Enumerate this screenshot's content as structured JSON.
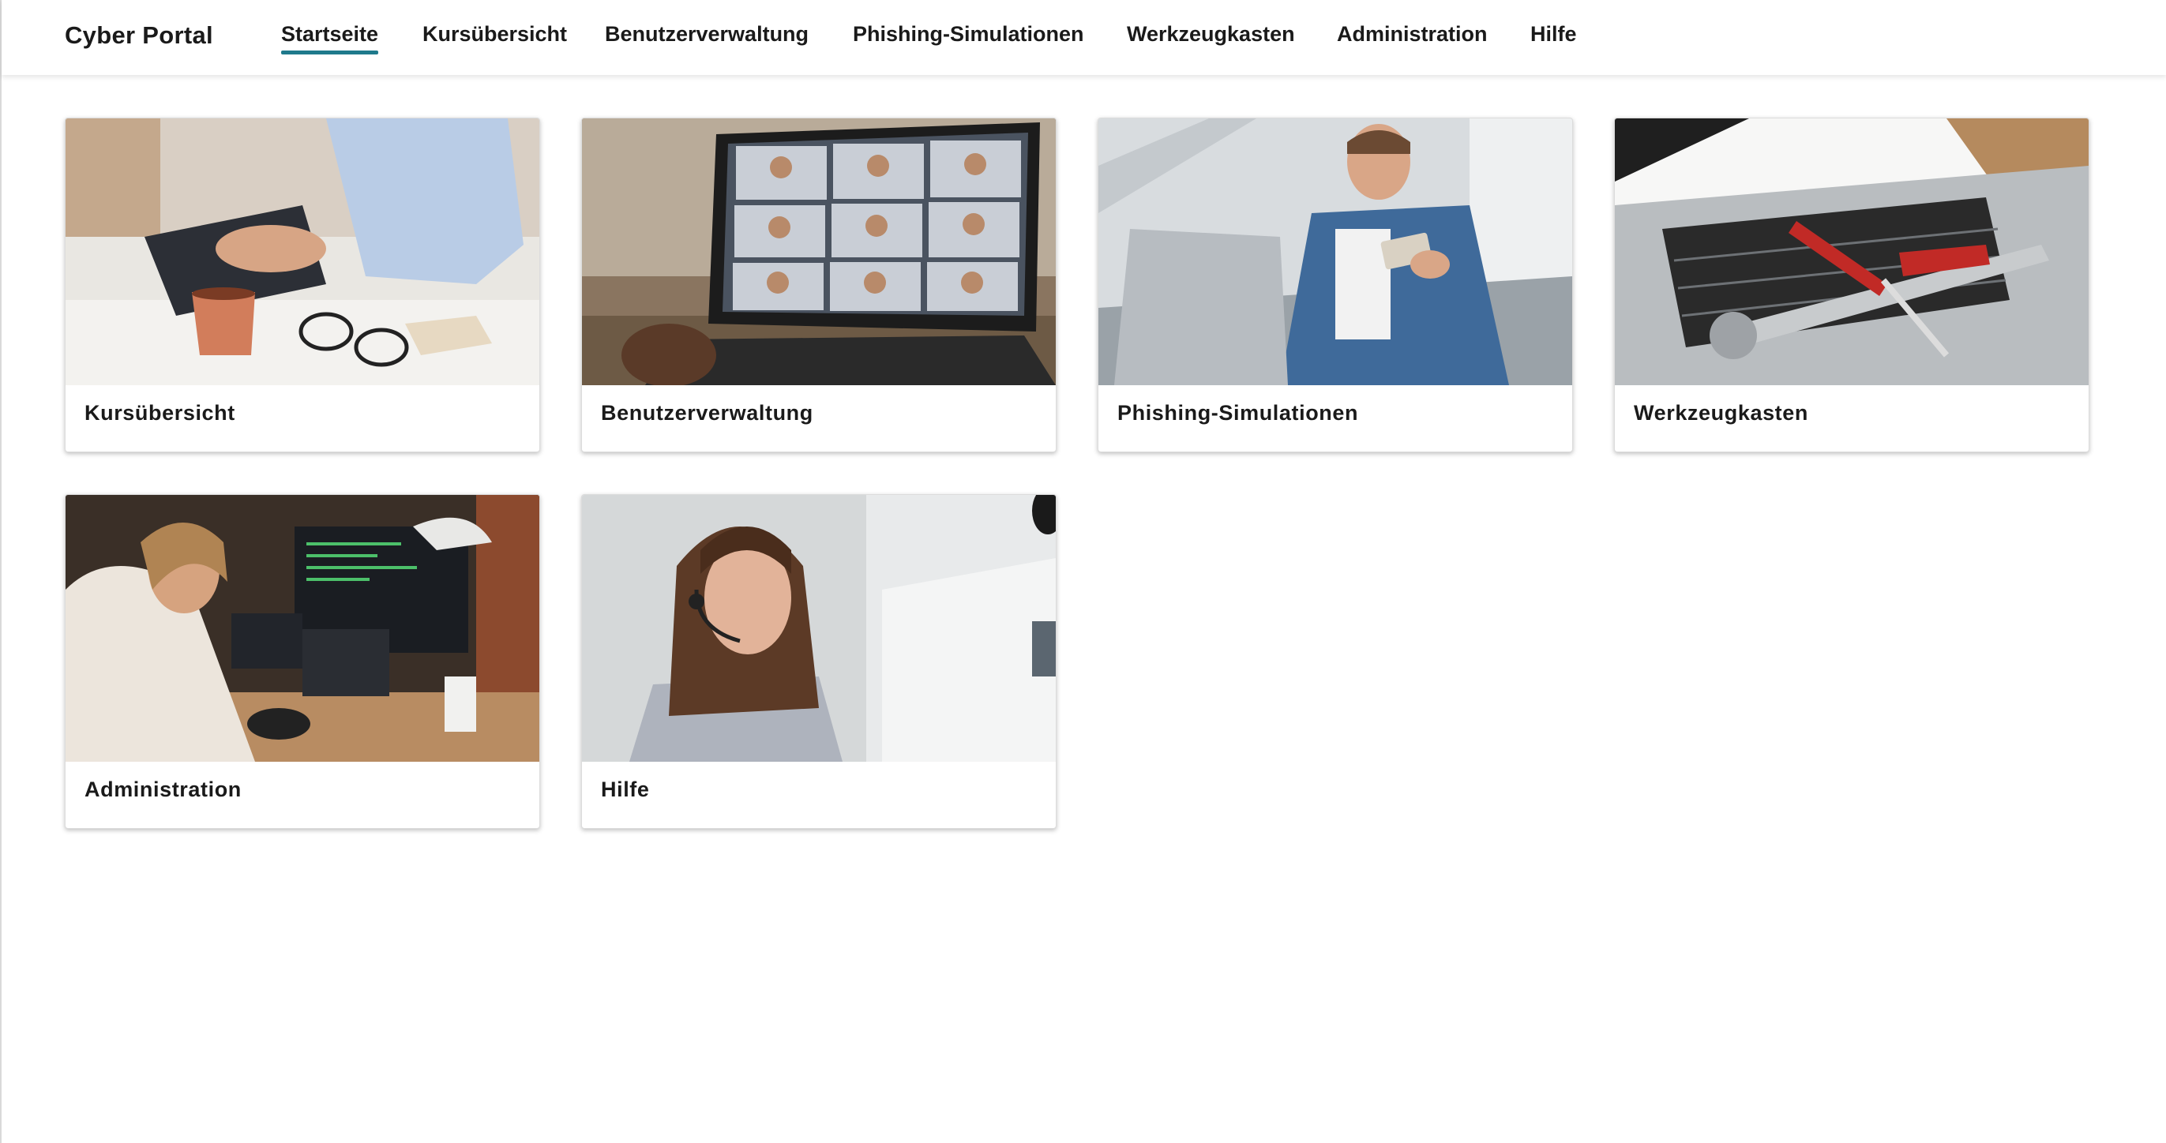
{
  "header": {
    "brand": "Cyber Portal",
    "nav": [
      {
        "label": "Startseite",
        "active": true
      },
      {
        "label": "Kursübersicht"
      },
      {
        "label": "Benutzerverwaltung"
      },
      {
        "label": "Phishing-Simulationen"
      },
      {
        "label": "Werkzeugkasten"
      },
      {
        "label": "Administration"
      },
      {
        "label": "Hilfe"
      }
    ],
    "accent_color": "#1f7a8c"
  },
  "cards": [
    {
      "label": "Kursübersicht",
      "image": "woman-typing-on-laptop-with-coffee-photo"
    },
    {
      "label": "Benutzerverwaltung",
      "image": "video-conference-on-laptop-photo"
    },
    {
      "label": "Phishing-Simulationen",
      "image": "man-with-laptop-and-credit-card-photo"
    },
    {
      "label": "Werkzeugkasten",
      "image": "screwdriver-and-wrench-on-laptop-photo"
    },
    {
      "label": "Administration",
      "image": "developer-at-multi-monitor-desk-photo"
    },
    {
      "label": "Hilfe",
      "image": "support-agent-with-headset-photo"
    }
  ]
}
